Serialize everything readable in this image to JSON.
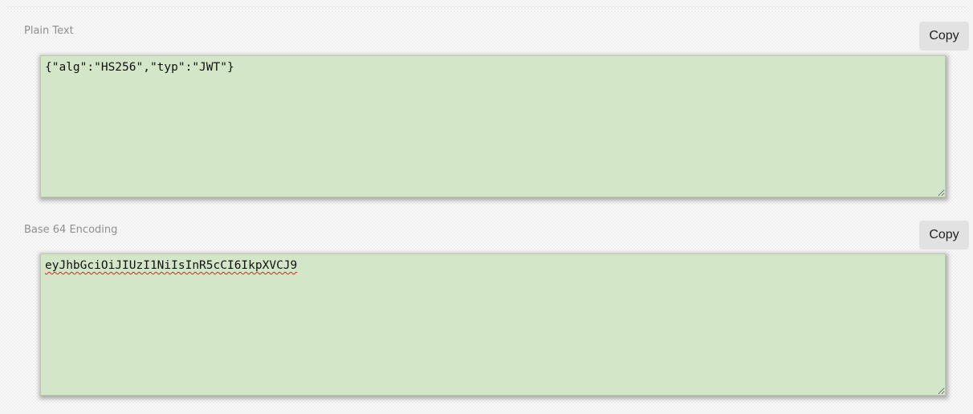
{
  "plain_text": {
    "label": "Plain Text",
    "value": "{\"alg\":\"HS256\",\"typ\":\"JWT\"}",
    "copy_label": "Copy"
  },
  "base64_encoding": {
    "label": "Base 64 Encoding",
    "value": "eyJhbGciOiJIUzI1NiIsInR5cCI6IkpXVCJ9",
    "copy_label": "Copy"
  },
  "colors": {
    "textarea_background": "#d4e6c8",
    "spellcheck_underline": "#e02020",
    "button_background": "#e2e2e2"
  }
}
